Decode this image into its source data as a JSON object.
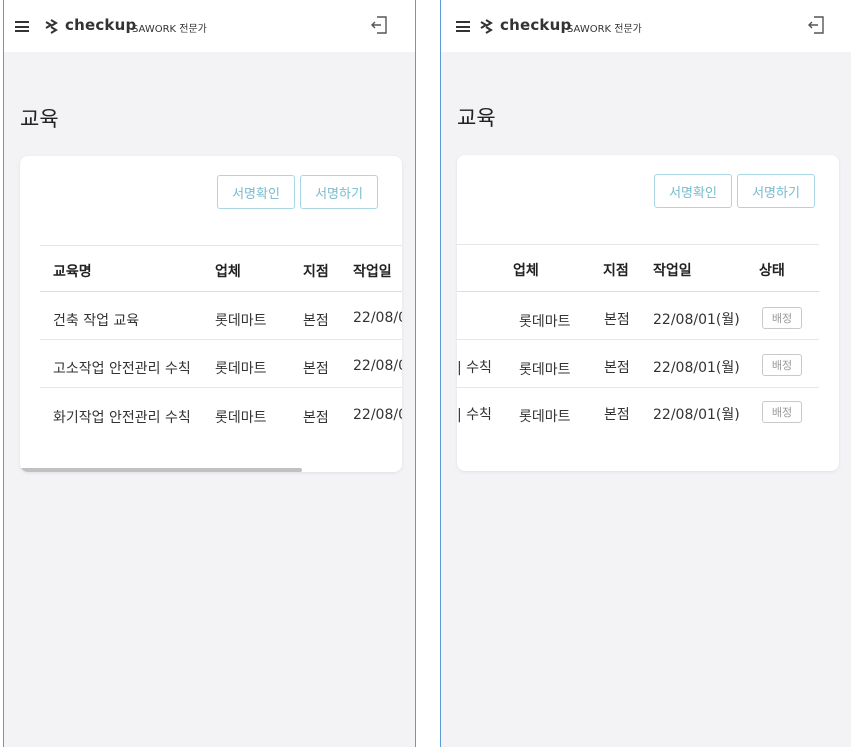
{
  "app": {
    "brand": "checkup",
    "sub_title": "SAWORK 전문가"
  },
  "page": {
    "title": "교육"
  },
  "actions": {
    "sign_confirm": "서명확인",
    "sign_do": "서명하기"
  },
  "table": {
    "columns": [
      "교육명",
      "업체",
      "지점",
      "작업일",
      "상태"
    ],
    "rows": [
      {
        "name": "건축 작업 교육",
        "company": "롯데마트",
        "branch": "본점",
        "date": "22/08/01(월)",
        "status": "배정"
      },
      {
        "name": "고소작업 안전관리 수칙",
        "company": "롯데마트",
        "branch": "본점",
        "date": "22/08/01(월)",
        "status": "배정"
      },
      {
        "name": "화기작업 안전관리 수칙",
        "company": "롯데마트",
        "branch": "본점",
        "date": "22/08/01(월)",
        "status": "배정"
      }
    ]
  },
  "screens": {
    "left_visible_date_clip": "22/08/0",
    "right_name_fragment": "| 수칙"
  },
  "colors": {
    "accent": "#77bcd0",
    "accent_border": "#a9d6e3",
    "frame": "#5b9bd5",
    "background": "#f3f3f5"
  }
}
